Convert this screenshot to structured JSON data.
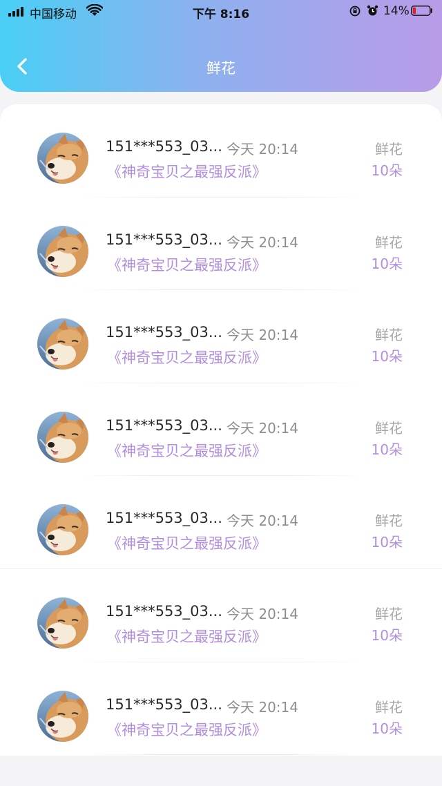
{
  "status_bar": {
    "carrier": "中国移动",
    "time": "下午 8:16",
    "battery": "14%"
  },
  "nav": {
    "title": "鲜花",
    "back_icon": "chevron-left-icon"
  },
  "colors": {
    "accent": "#b38ee0",
    "header_gradient": [
      "#49cff5",
      "#b99be8"
    ]
  },
  "records": [
    {
      "user": "151***553_03...",
      "time": "今天 20:14",
      "book": "《神奇宝贝之最强反派》",
      "gift": "鲜花",
      "count": "10朵"
    },
    {
      "user": "151***553_03...",
      "time": "今天 20:14",
      "book": "《神奇宝贝之最强反派》",
      "gift": "鲜花",
      "count": "10朵"
    },
    {
      "user": "151***553_03...",
      "time": "今天 20:14",
      "book": "《神奇宝贝之最强反派》",
      "gift": "鲜花",
      "count": "10朵"
    },
    {
      "user": "151***553_03...",
      "time": "今天 20:14",
      "book": "《神奇宝贝之最强反派》",
      "gift": "鲜花",
      "count": "10朵"
    },
    {
      "user": "151***553_03...",
      "time": "今天 20:14",
      "book": "《神奇宝贝之最强反派》",
      "gift": "鲜花",
      "count": "10朵"
    },
    {
      "user": "151***553_03...",
      "time": "今天 20:14",
      "book": "《神奇宝贝之最强反派》",
      "gift": "鲜花",
      "count": "10朵"
    },
    {
      "user": "151***553_03...",
      "time": "今天 20:14",
      "book": "《神奇宝贝之最强反派》",
      "gift": "鲜花",
      "count": "10朵"
    }
  ]
}
